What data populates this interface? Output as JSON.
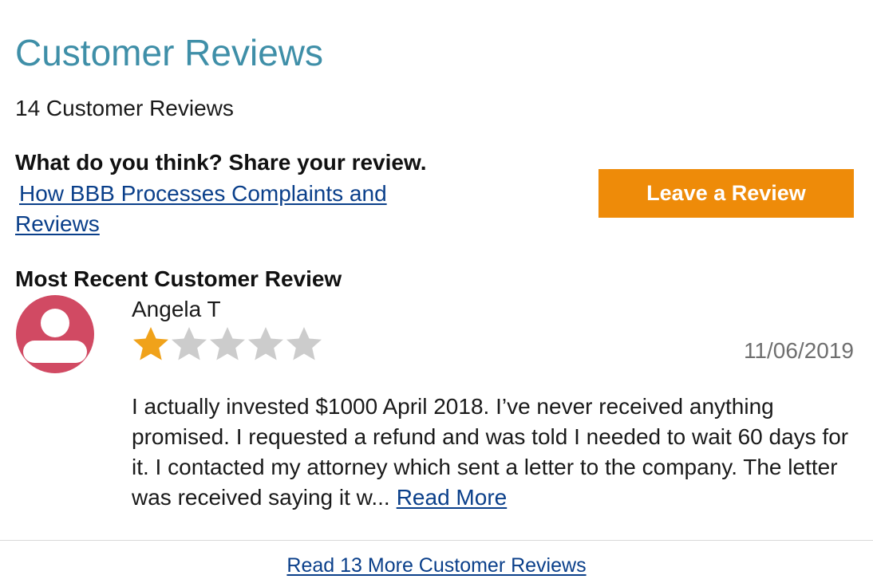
{
  "header": {
    "title": "Customer Reviews",
    "count_text": "14 Customer Reviews"
  },
  "share": {
    "prompt": "What do you think? Share your review.",
    "process_link": "How BBB Processes Complaints and Reviews",
    "leave_button": "Leave a Review"
  },
  "recent": {
    "heading": "Most Recent Customer Review",
    "reviewer_name": "Angela T",
    "avatar_icon": "user-avatar-icon",
    "rating": 1,
    "rating_max": 5,
    "date": "11/06/2019",
    "text": "I actually invested $1000 April 2018. I’ve never received anything promised. I requested a refund and was told I needed to wait 60 days for it. I contacted my attorney which sent a letter to the company. The letter was received saying it w...",
    "read_more": "Read More"
  },
  "footer": {
    "more_link": "Read 13 More Customer Reviews"
  },
  "colors": {
    "title": "#3f8fa8",
    "button": "#ee8b09",
    "link": "#0a3f8a",
    "avatar": "#d14a63",
    "star_filled": "#f0a21a",
    "star_empty": "#cccccc"
  }
}
